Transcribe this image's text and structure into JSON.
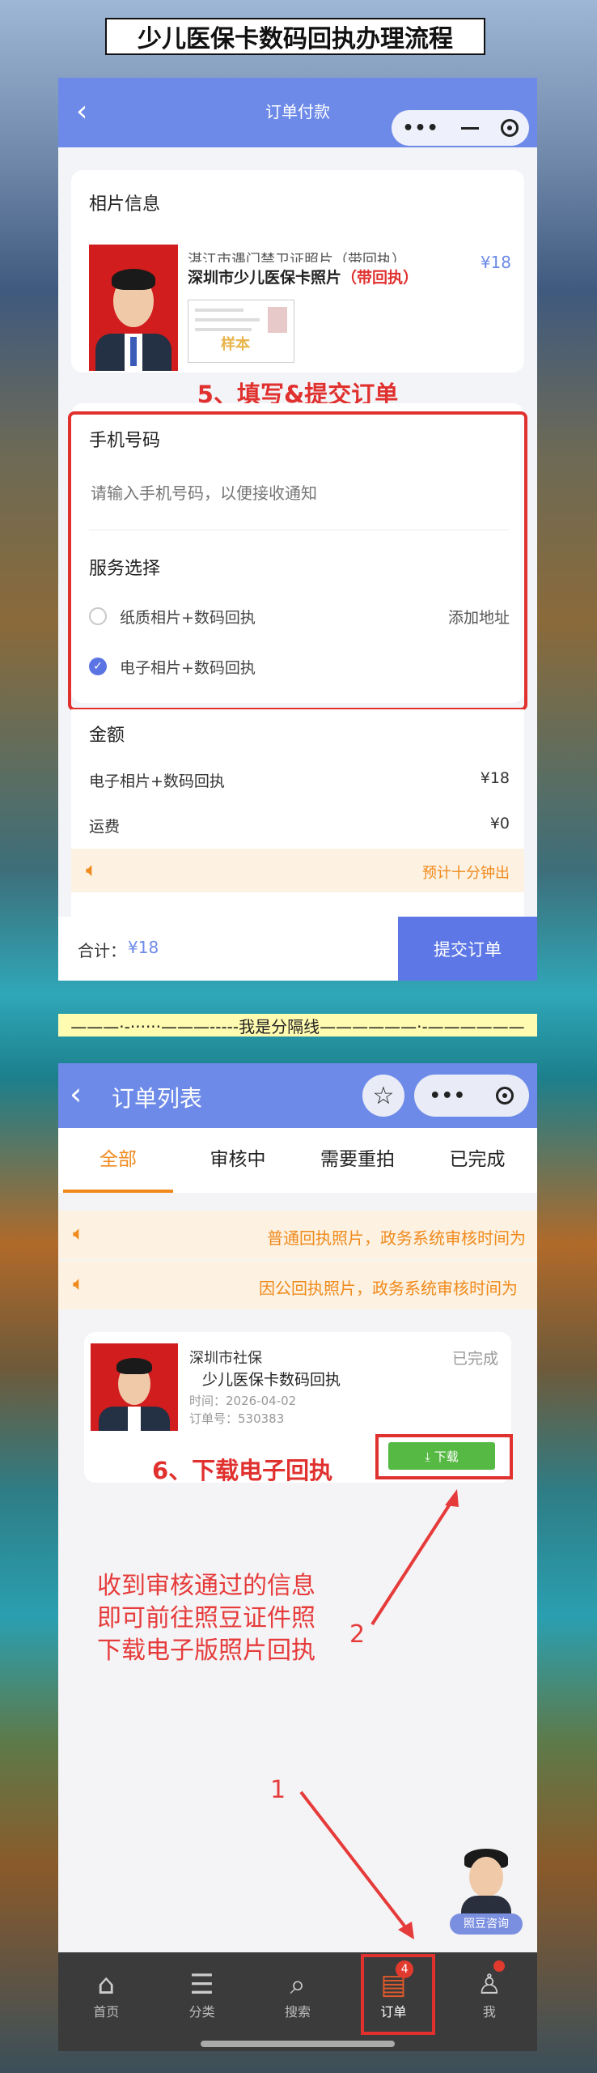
{
  "banner_title": "少儿医保卡数码回执办理流程",
  "screen1": {
    "nav_title": "订单付款",
    "photo_section_title": "相片信息",
    "product_name_ghost": "湛江市遇门禁卫证照片（带回执）",
    "product_name": "深圳市少儿医保卡照片",
    "product_name_suffix": "（带回执）",
    "product_price": "¥18",
    "sample_stamp": "样本",
    "step_note": "5、填写&提交订单",
    "phone_label": "手机号码",
    "phone_placeholder": "请输入手机号码，以便接收通知",
    "service_label": "服务选择",
    "options": [
      {
        "label": "纸质相片+数码回执",
        "extra": "添加地址",
        "selected": false
      },
      {
        "label": "电子相片+数码回执",
        "extra": "",
        "selected": true
      }
    ],
    "amount_label": "金额",
    "amount_rows": [
      {
        "label": "电子相片+数码回执",
        "value": "¥18"
      },
      {
        "label": "运费",
        "value": "¥0"
      }
    ],
    "notice_text": "预计十分钟出",
    "total_label": "合计：",
    "total_value": "¥18",
    "submit_label": "提交订单"
  },
  "separator_text": "———·-······———-----我是分隔线——————·-——————",
  "screen2": {
    "nav_title": "订单列表",
    "tabs": [
      "全部",
      "审核中",
      "需要重拍",
      "已完成"
    ],
    "notices": [
      "普通回执照片，政务系统审核时间为",
      "因公回执照片，政务系统审核时间为"
    ],
    "order": {
      "city": "深圳市社保",
      "status": "已完成",
      "product": "少儿医保卡数码回执",
      "time": "时间：2026-04-02",
      "order_no": "订单号：530383",
      "download_label": "⤓ 下载"
    },
    "step_note": "6、下载电子回执",
    "annotation_lines": [
      "收到审核通过的信息",
      "即可前往照豆证件照",
      "下载电子版照片回执"
    ],
    "marker_1": "1",
    "marker_2": "2",
    "consult_label": "照豆咨询",
    "tabbar": [
      {
        "label": "首页",
        "icon": "home-icon",
        "glyph": "⌂"
      },
      {
        "label": "分类",
        "icon": "category-icon",
        "glyph": "☰"
      },
      {
        "label": "搜索",
        "icon": "search-icon",
        "glyph": "⌕"
      },
      {
        "label": "订单",
        "icon": "order-icon",
        "glyph": "▤",
        "badge": "4"
      },
      {
        "label": "我",
        "icon": "user-icon",
        "glyph": "♙"
      }
    ]
  },
  "colors": {
    "accent_blue": "#6d8ae8",
    "red": "#e0312f",
    "orange": "#f08a1c",
    "green": "#55b943"
  }
}
